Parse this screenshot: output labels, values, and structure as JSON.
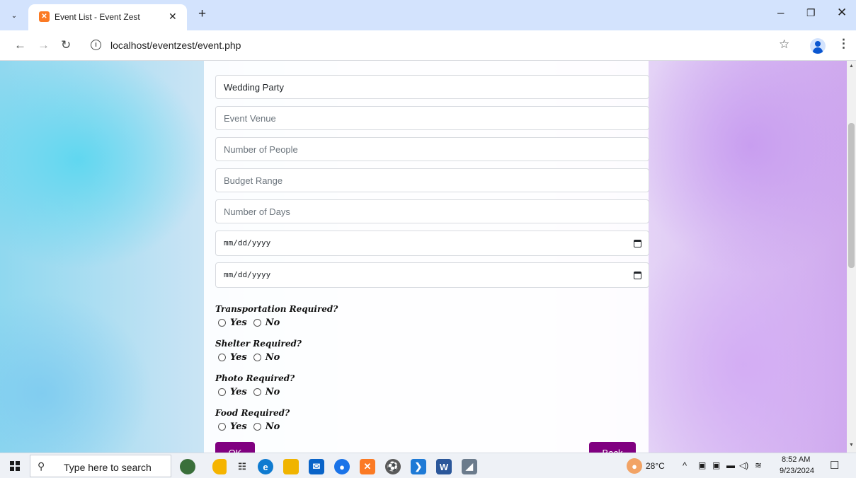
{
  "browser": {
    "tab_title": "Event List - Event Zest",
    "tab_close": "✕",
    "new_tab": "+",
    "url": "localhost/eventzest/event.php"
  },
  "form": {
    "event_name_value": "Wedding Party",
    "venue_placeholder": "Event Venue",
    "people_placeholder": "Number of People",
    "budget_placeholder": "Budget Range",
    "days_placeholder": "Number of Days",
    "start_date_placeholder": "mm/dd/yyyy",
    "end_date_placeholder": "mm/dd/yyyy",
    "questions": [
      {
        "label": "Transportation Required?",
        "yes": "Yes",
        "no": "No"
      },
      {
        "label": "Shelter Required?",
        "yes": "Yes",
        "no": "No"
      },
      {
        "label": "Photo Required?",
        "yes": "Yes",
        "no": "No"
      },
      {
        "label": "Food Required?",
        "yes": "Yes",
        "no": "No"
      }
    ],
    "ok_label": "OK",
    "back_label": "Back",
    "button_color": "#800080"
  },
  "taskbar": {
    "search_placeholder": "Type here to search",
    "weather": "28°C",
    "time": "8:52 AM",
    "date": "9/23/2024"
  }
}
